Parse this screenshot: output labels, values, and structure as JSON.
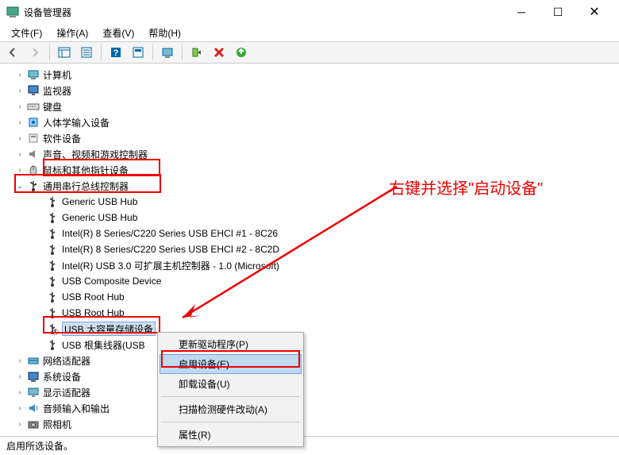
{
  "window": {
    "title": "设备管理器"
  },
  "menu": {
    "file": "文件(F)",
    "action": "操作(A)",
    "view": "查看(V)",
    "help": "帮助(H)"
  },
  "tree": {
    "items": [
      {
        "label": "计算机",
        "icon": "computer"
      },
      {
        "label": "监视器",
        "icon": "monitor"
      },
      {
        "label": "键盘",
        "icon": "keyboard"
      },
      {
        "label": "人体学输入设备",
        "icon": "hid"
      },
      {
        "label": "软件设备",
        "icon": "software"
      },
      {
        "label": "声音、视频和游戏控制器",
        "icon": "sound"
      },
      {
        "label": "鼠标和其他指针设备",
        "icon": "mouse"
      }
    ],
    "usb_category": "通用串行总线控制器",
    "usb_children": [
      "Generic USB Hub",
      "Generic USB Hub",
      "Intel(R) 8 Series/C220 Series USB EHCI #1 - 8C26",
      "Intel(R) 8 Series/C220 Series USB EHCI #2 - 8C2D",
      "Intel(R) USB 3.0 可扩展主机控制器 - 1.0 (Microsoft)",
      "USB Composite Device",
      "USB Root Hub",
      "USB Root Hub",
      "USB 大容量存储设备",
      "USB 根集线器(USB"
    ],
    "tail": [
      {
        "label": "网络适配器",
        "icon": "network"
      },
      {
        "label": "系统设备",
        "icon": "system"
      },
      {
        "label": "显示适配器",
        "icon": "display"
      },
      {
        "label": "音频输入和输出",
        "icon": "audio"
      },
      {
        "label": "照相机",
        "icon": "camera"
      }
    ]
  },
  "contextmenu": {
    "update": "更新驱动程序(P)",
    "enable": "启用设备(E)",
    "uninstall": "卸载设备(U)",
    "scan": "扫描检测硬件改动(A)",
    "properties": "属性(R)"
  },
  "annotation": "右键并选择\"启动设备\"",
  "statusbar": "启用所选设备。"
}
